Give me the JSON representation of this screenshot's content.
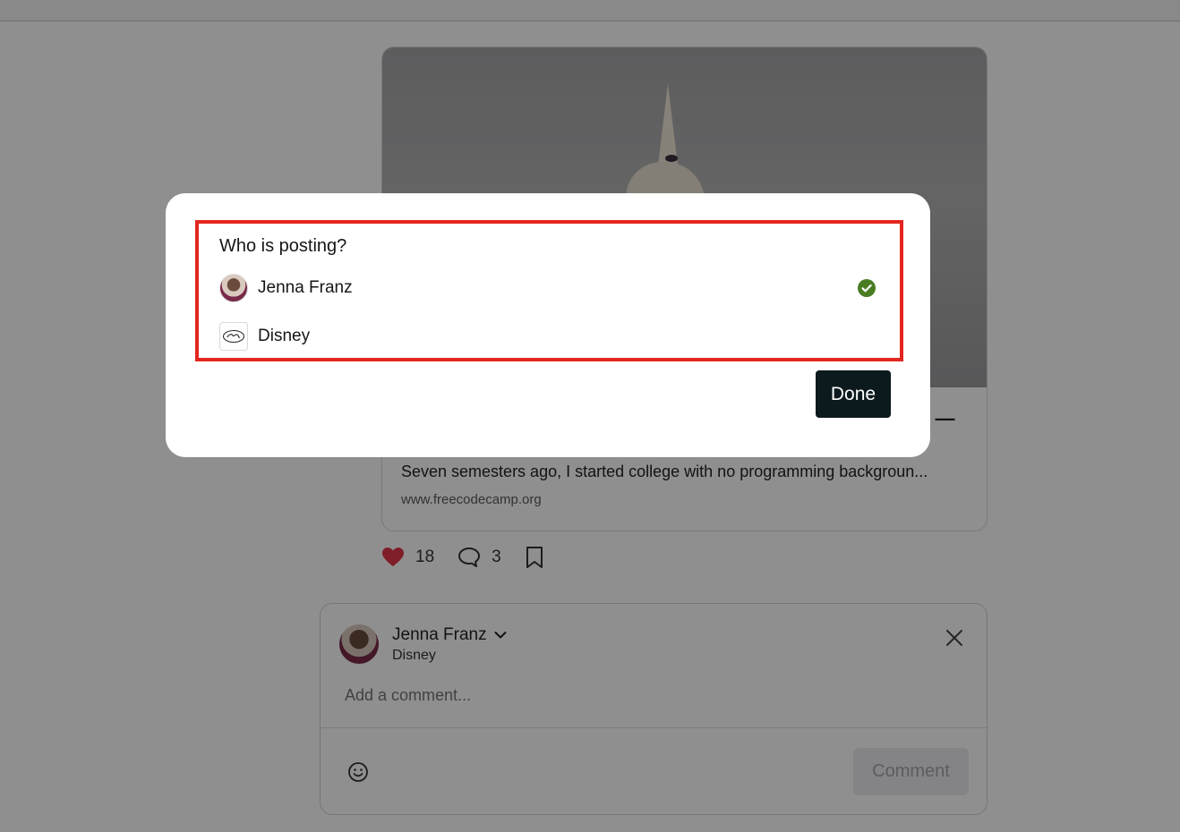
{
  "post": {
    "headline_tail": "o —",
    "description": "Seven semesters ago, I started college with no programming backgroun...",
    "link": "www.freecodecamp.org",
    "likes": "18",
    "comments": "3"
  },
  "comment_box": {
    "author_name": "Jenna Franz",
    "author_org": "Disney",
    "input_placeholder": "Add a comment...",
    "submit_label": "Comment"
  },
  "modal": {
    "title": "Who is posting?",
    "options": [
      {
        "label": "Jenna Franz",
        "selected": true
      },
      {
        "label": "Disney",
        "selected": false
      }
    ],
    "done_label": "Done"
  },
  "colors": {
    "like_heart": "#e3364a",
    "selected_check": "#4a7d23",
    "highlight_border": "#e3261f",
    "done_button": "#0d1a1d"
  },
  "icons": [
    "heart-icon",
    "comment-icon",
    "bookmark-icon",
    "chevron-down-icon",
    "close-icon",
    "emoji-icon",
    "check-circle-icon"
  ]
}
